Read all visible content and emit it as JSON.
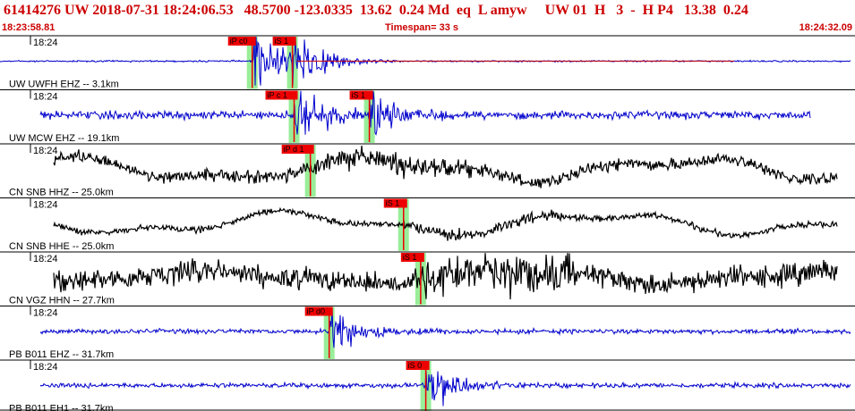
{
  "header": {
    "title_line": "61414276 UW 2018-07-31 18:24:06.53   48.5700 -123.0335  13.62  0.24 Md  eq  L amyw     UW 01  H   3  -  H P4   13.38  0.24",
    "start_time": "18:23:58.81",
    "timespan": "Timespan=  33 s",
    "end_time": "18:24:32.09"
  },
  "colors": {
    "header_text": "#cc0000",
    "blue_trace": "#0000cc",
    "black_trace": "#000000",
    "red_trace": "#cc0000",
    "pick_flag": "#ee0000",
    "pick_band": "#99ee99"
  },
  "traces": [
    {
      "time_label": "18:24",
      "label": "UW UWFH EHZ -- 3.1km",
      "color": "blue",
      "style": "impulse",
      "amp": 0.45,
      "noise": 0.01,
      "picks": [
        {
          "label": "iP c0",
          "t": 0.295
        },
        {
          "label": "iS 1",
          "t": 0.342
        }
      ]
    },
    {
      "time_label": "18:24",
      "label": "UW MCW EHZ -- 19.1km",
      "color": "blue",
      "style": "impulse",
      "amp": 0.4,
      "noise": 0.05,
      "picks": [
        {
          "label": "iP c 1",
          "t": 0.344
        },
        {
          "label": "iS 1",
          "t": 0.432
        }
      ]
    },
    {
      "time_label": "18:24",
      "label": "CN SNB HHZ -- 25.0km",
      "color": "black",
      "style": "wave",
      "amp": 0.3,
      "noise": 0.08,
      "picks": [
        {
          "label": "iP d 1",
          "t": 0.363
        }
      ]
    },
    {
      "time_label": "18:24",
      "label": "CN SNB HHE -- 25.0km",
      "color": "black",
      "style": "wave",
      "amp": 0.3,
      "noise": 0.04,
      "picks": [
        {
          "label": "iS 1",
          "t": 0.472
        }
      ]
    },
    {
      "time_label": "18:24",
      "label": "CN VGZ HHN -- 27.7km",
      "color": "black",
      "style": "wave",
      "amp": 0.2,
      "noise": 0.14,
      "picks": [
        {
          "label": "iS 1",
          "t": 0.492
        }
      ]
    },
    {
      "time_label": "18:24",
      "label": "PB B011 EHZ -- 31.7km",
      "color": "blue",
      "style": "impulse",
      "amp": 0.3,
      "noise": 0.03,
      "picks": [
        {
          "label": "iP d0",
          "t": 0.385
        }
      ]
    },
    {
      "time_label": "18:24",
      "label": "PB B011 EH1 -- 31.7km",
      "color": "blue",
      "style": "impulse",
      "amp": 0.35,
      "noise": 0.03,
      "picks": [
        {
          "label": "iS 0",
          "t": 0.498
        }
      ]
    }
  ]
}
